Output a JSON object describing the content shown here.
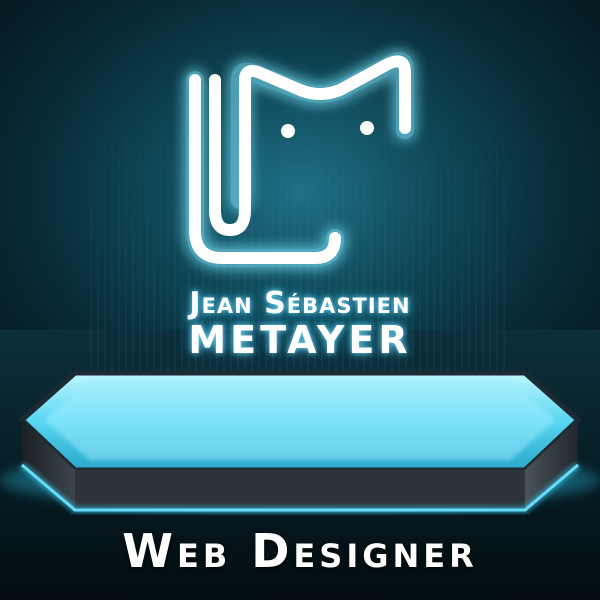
{
  "profile": {
    "first_name": "Jean Sébastien",
    "last_name": "METAYER",
    "title": "Web Designer"
  },
  "logo": {
    "icon": "cat-logo-icon",
    "lettering": "JSM"
  },
  "colors": {
    "glow": "#7fe8ff",
    "neon_stroke": "#ffffff",
    "background_dark": "#04141a",
    "background_mid": "#0f4656",
    "text": "#ffffff"
  }
}
